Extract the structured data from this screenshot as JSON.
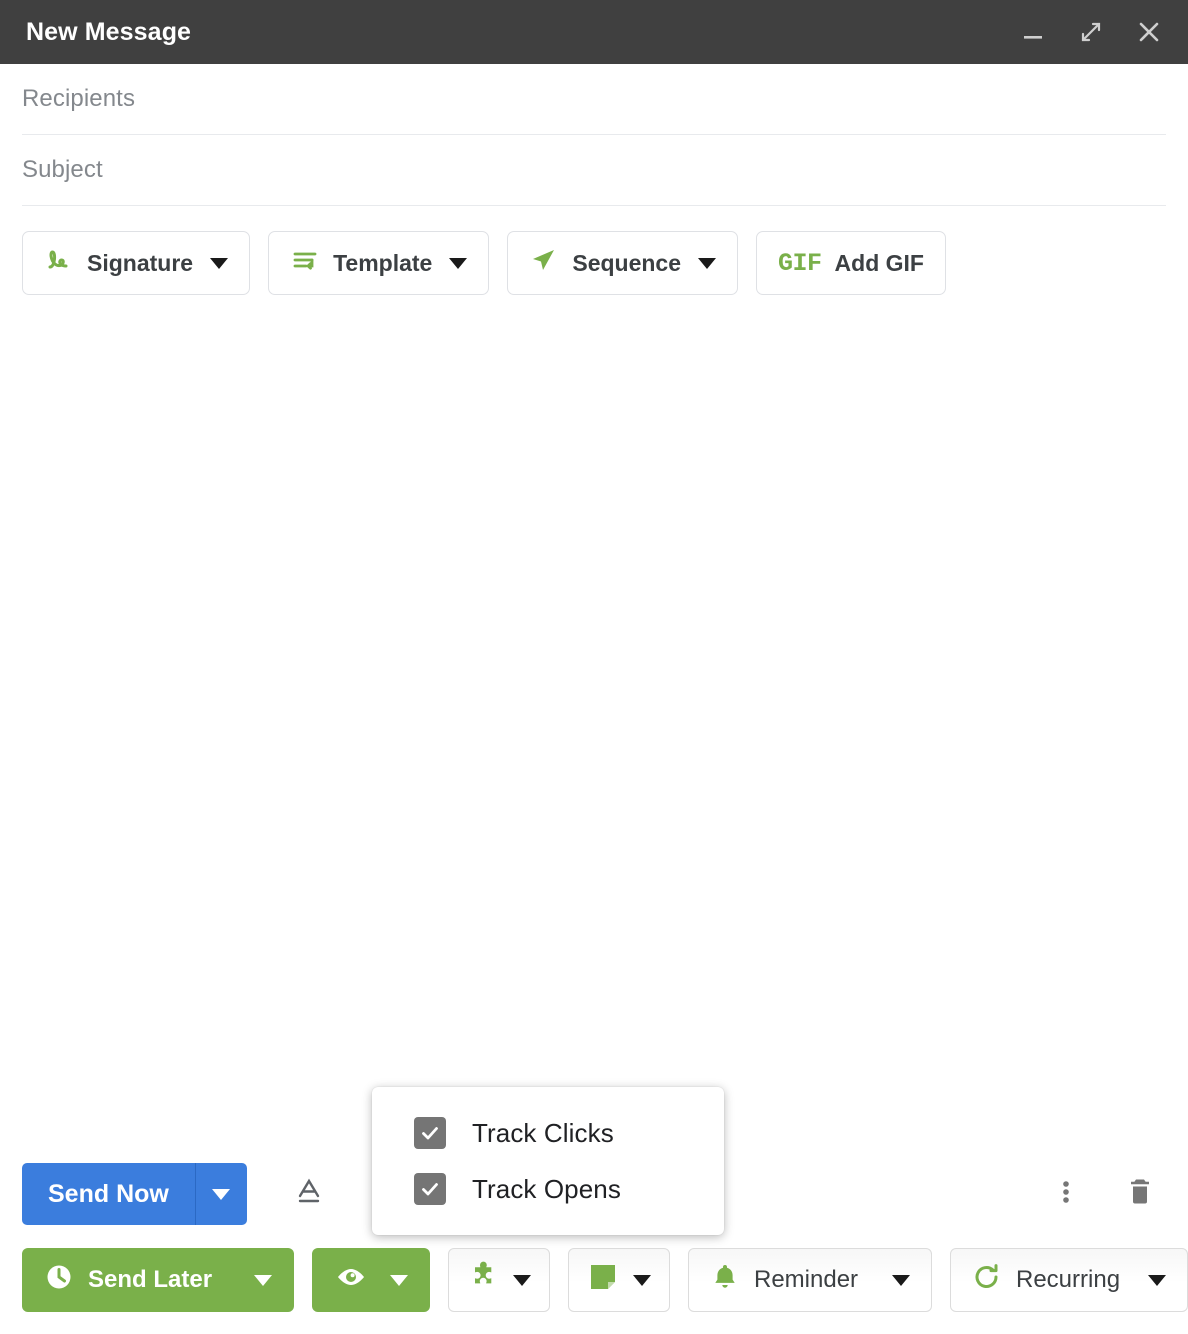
{
  "window": {
    "title": "New Message",
    "controls": [
      {
        "name": "minimize",
        "icon": "minimize-icon"
      },
      {
        "name": "expand",
        "icon": "expand-icon"
      },
      {
        "name": "close",
        "icon": "close-icon"
      }
    ]
  },
  "fields": {
    "recipients_placeholder": "Recipients",
    "subject_placeholder": "Subject",
    "recipients_value": "",
    "subject_value": ""
  },
  "compose_toolbar": {
    "buttons": [
      {
        "label": "Signature",
        "icon": "signature-icon",
        "has_caret": true
      },
      {
        "label": "Template",
        "icon": "template-icon",
        "has_caret": true
      },
      {
        "label": "Sequence",
        "icon": "sequence-icon",
        "has_caret": true
      },
      {
        "label": "Add GIF",
        "icon": "gif-icon",
        "has_caret": false,
        "icon_text": "GIF"
      }
    ]
  },
  "body": {
    "content": ""
  },
  "tracking_popup": {
    "visible": true,
    "items": [
      {
        "label": "Track Clicks",
        "checked": true
      },
      {
        "label": "Track Opens",
        "checked": true
      }
    ]
  },
  "actions": {
    "send_now_label": "Send Now",
    "send_dropdown": "send-options-caret",
    "format_icon": "text-format-icon",
    "attach_icon": "attachment-icon",
    "more_icon": "more-options-icon",
    "delete_icon": "trash-icon"
  },
  "tools": [
    {
      "label": "Send Later",
      "icon": "clock-icon",
      "style": "green",
      "has_caret": true
    },
    {
      "label": "",
      "icon": "eye-icon",
      "style": "green",
      "has_caret": true
    },
    {
      "label": "",
      "icon": "puzzle-icon",
      "style": "outline",
      "has_caret": true
    },
    {
      "label": "",
      "icon": "sticky-note-icon",
      "style": "outline",
      "has_caret": true
    },
    {
      "label": "Reminder",
      "icon": "bell-icon",
      "style": "outline",
      "has_caret": true
    },
    {
      "label": "Recurring",
      "icon": "recurring-icon",
      "style": "outline",
      "has_caret": true
    }
  ],
  "colors": {
    "titlebar": "#404040",
    "accent_green": "#7ab04a",
    "accent_blue": "#3b7ddd",
    "checkbox_gray": "#757575",
    "placeholder_gray": "#84888d",
    "border_gray": "#dfe1e5"
  }
}
